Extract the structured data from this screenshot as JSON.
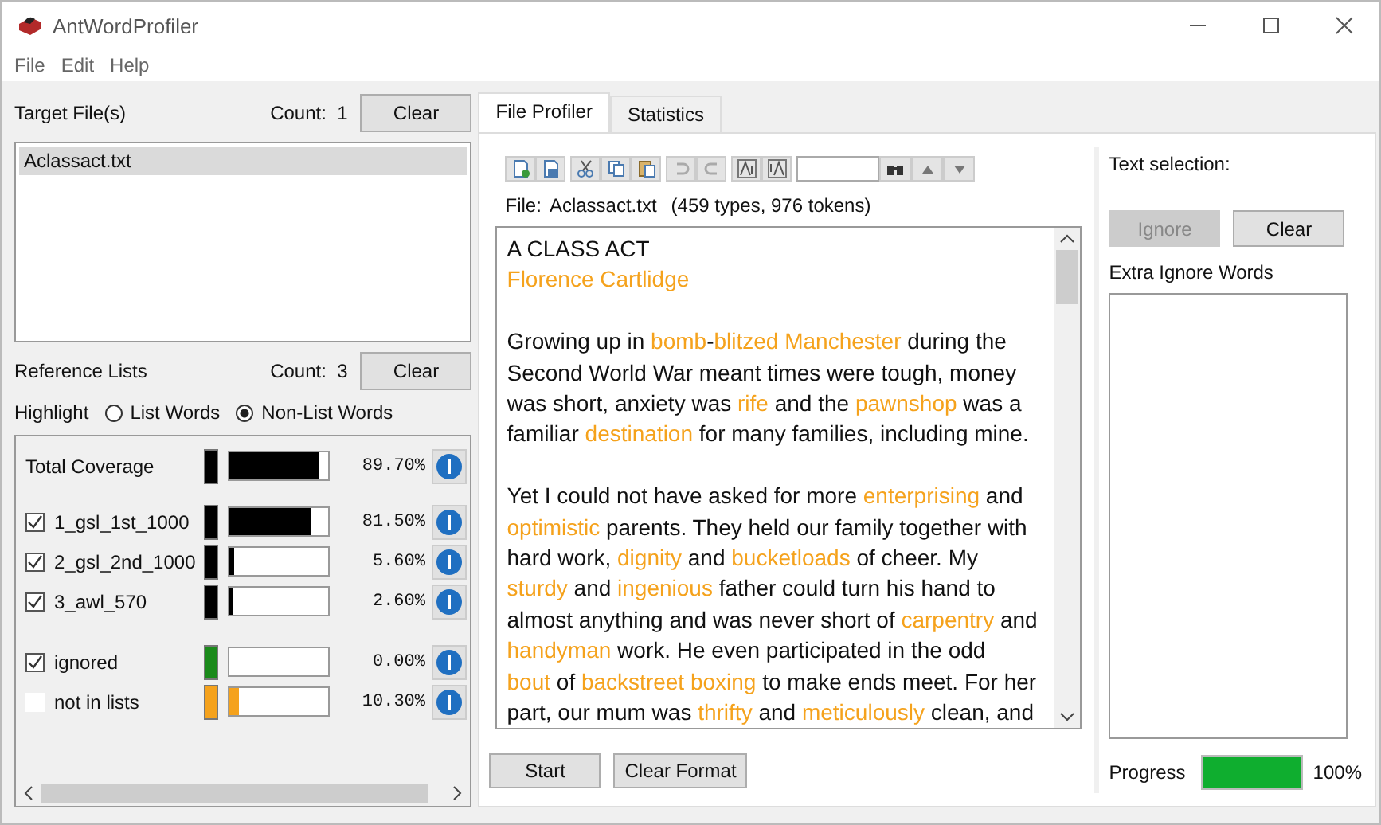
{
  "window": {
    "title": "AntWordProfiler"
  },
  "menu": [
    "File",
    "Edit",
    "Help"
  ],
  "target_files": {
    "label": "Target File(s)",
    "count_label": "Count:",
    "count": "1",
    "clear_button": "Clear",
    "files": [
      {
        "name": "Aclassact.txt",
        "selected": true
      }
    ]
  },
  "reference_lists": {
    "label": "Reference Lists",
    "count_label": "Count:",
    "count": "3",
    "clear_button": "Clear"
  },
  "highlight": {
    "label": "Highlight",
    "options": [
      {
        "label": "List Words",
        "selected": false
      },
      {
        "label": "Non-List Words",
        "selected": true
      }
    ]
  },
  "coverage": [
    {
      "kind": "total",
      "name": "Total Coverage",
      "color": "#000000",
      "level": 0.897,
      "percent": "89.70%"
    },
    {
      "kind": "list",
      "name": "1_gsl_1st_1000",
      "checked": true,
      "color": "#000000",
      "level": 0.815,
      "percent": "81.50%"
    },
    {
      "kind": "list",
      "name": "2_gsl_2nd_1000",
      "checked": true,
      "color": "#000000",
      "level": 0.056,
      "percent": "5.60%"
    },
    {
      "kind": "list",
      "name": "3_awl_570",
      "checked": true,
      "color": "#000000",
      "level": 0.026,
      "percent": "2.60%"
    },
    {
      "kind": "other",
      "name": "ignored",
      "checked": true,
      "color": "#1a8a1a",
      "level": 0.0,
      "percent": "0.00%"
    },
    {
      "kind": "list",
      "name": "not in lists",
      "checked": false,
      "color": "#f5a21c",
      "level": 0.103,
      "percent": "10.30%"
    }
  ],
  "tabs": [
    {
      "label": "File Profiler",
      "selected": true
    },
    {
      "label": "Statistics",
      "selected": false
    }
  ],
  "file_info": {
    "label": "File:",
    "name": "Aclassact.txt",
    "summary": "(459 types, 976 tokens)"
  },
  "document": [
    [
      [
        {
          "text": "A CLASS ACT",
          "highlighted": false
        }
      ],
      [
        {
          "text": "Florence Cartlidge",
          "highlighted": true
        }
      ]
    ],
    [
      [
        {
          "text": "Growing up in ",
          "highlighted": false
        },
        {
          "text": "bomb",
          "highlighted": true
        },
        {
          "text": "-",
          "highlighted": false
        },
        {
          "text": "blitzed Manchester",
          "highlighted": true
        },
        {
          "text": " during the",
          "highlighted": false
        }
      ],
      [
        {
          "text": "Second World War meant times were tough, money",
          "highlighted": false
        }
      ],
      [
        {
          "text": "was short, anxiety was ",
          "highlighted": false
        },
        {
          "text": "rife",
          "highlighted": true
        },
        {
          "text": " and the ",
          "highlighted": false
        },
        {
          "text": "pawnshop",
          "highlighted": true
        },
        {
          "text": " was a",
          "highlighted": false
        }
      ],
      [
        {
          "text": "familiar ",
          "highlighted": false
        },
        {
          "text": "destination",
          "highlighted": true
        },
        {
          "text": " for many families, including mine.",
          "highlighted": false
        }
      ]
    ],
    [
      [
        {
          "text": "Yet I could not have asked for more ",
          "highlighted": false
        },
        {
          "text": "enterprising",
          "highlighted": true
        },
        {
          "text": " and",
          "highlighted": false
        }
      ],
      [
        {
          "text": "optimistic",
          "highlighted": true
        },
        {
          "text": " parents. They held our family together with",
          "highlighted": false
        }
      ],
      [
        {
          "text": "hard work, ",
          "highlighted": false
        },
        {
          "text": "dignity",
          "highlighted": true
        },
        {
          "text": " and ",
          "highlighted": false
        },
        {
          "text": "bucketloads",
          "highlighted": true
        },
        {
          "text": " of cheer. My",
          "highlighted": false
        }
      ],
      [
        {
          "text": "sturdy",
          "highlighted": true
        },
        {
          "text": " and ",
          "highlighted": false
        },
        {
          "text": "ingenious",
          "highlighted": true
        },
        {
          "text": " father could turn his hand to",
          "highlighted": false
        }
      ],
      [
        {
          "text": "almost anything and was never short of ",
          "highlighted": false
        },
        {
          "text": "carpentry",
          "highlighted": true
        },
        {
          "text": " and",
          "highlighted": false
        }
      ],
      [
        {
          "text": "handyman",
          "highlighted": true
        },
        {
          "text": " work. He even participated in the odd",
          "highlighted": false
        }
      ],
      [
        {
          "text": "bout",
          "highlighted": true
        },
        {
          "text": " of ",
          "highlighted": false
        },
        {
          "text": "backstreet boxing",
          "highlighted": true
        },
        {
          "text": " to make ends meet. For her",
          "highlighted": false
        }
      ],
      [
        {
          "text": "part, our mum was ",
          "highlighted": false
        },
        {
          "text": "thrifty",
          "highlighted": true
        },
        {
          "text": " and ",
          "highlighted": false
        },
        {
          "text": "meticulously",
          "highlighted": true
        },
        {
          "text": " clean, and",
          "highlighted": false
        }
      ]
    ]
  ],
  "bottom_buttons": [
    "Start",
    "Clear Format"
  ],
  "text_selection": {
    "label": "Text selection:",
    "ignore_button": {
      "label": "Ignore",
      "disabled": true
    },
    "clear_button": {
      "label": "Clear",
      "disabled": false
    }
  },
  "extra_ignore_words": {
    "label": "Extra Ignore Words"
  },
  "progress": {
    "label": "Progress",
    "level": 1.0,
    "reading": "100%"
  }
}
